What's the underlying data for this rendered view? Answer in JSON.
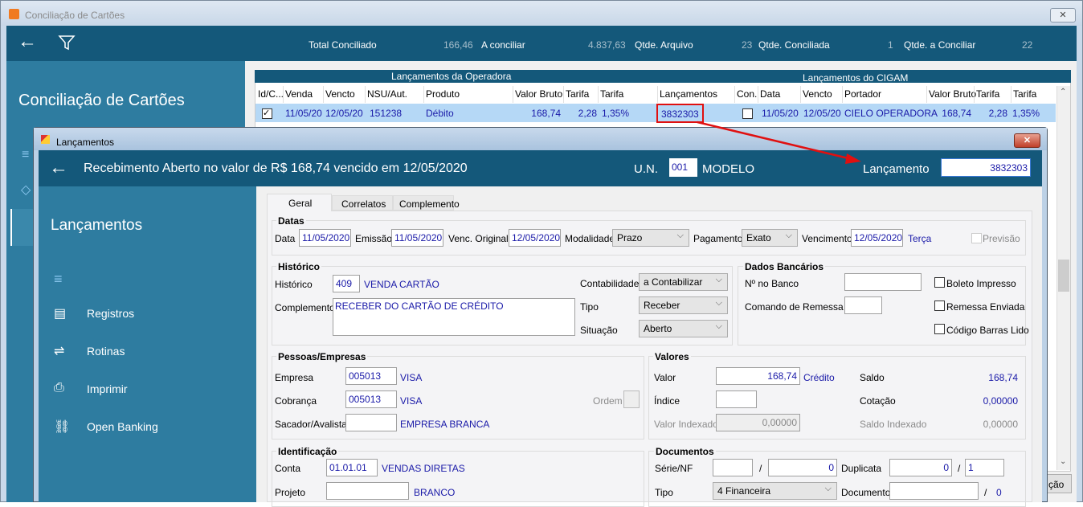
{
  "main_window": {
    "title": "Conciliação de Cartões",
    "close": "✕"
  },
  "summary": {
    "total_conciliado_label": "Total Conciliado",
    "total_conciliado": "166,46",
    "a_conciliar_label": "A conciliar",
    "a_conciliar": "4.837,63",
    "qtde_arquivo_label": "Qtde. Arquivo",
    "qtde_arquivo": "23",
    "qtde_conciliada_label": "Qtde. Conciliada",
    "qtde_conciliada": "1",
    "qtde_a_conciliar_label": "Qtde. a Conciliar",
    "qtde_a_conciliar": "22"
  },
  "sidebar": {
    "title": "Conciliação de Cartões"
  },
  "grid": {
    "operadora_title": "Lançamentos da Operadora",
    "cigam_title": "Lançamentos do CIGAM",
    "headers": [
      "Id/C...",
      "Venda",
      "Vencto",
      "NSU/Aut.",
      "Produto",
      "Valor Bruto",
      "Tarifa",
      "Tarifa",
      "Lançamentos",
      "Con.",
      "Data",
      "Vencto",
      "Portador",
      "Valor Bruto",
      "Tarifa",
      "Tarifa"
    ],
    "row": {
      "venda": "11/05/20",
      "vencto": "12/05/20",
      "nsu": "151238",
      "produto": "Débito",
      "valor_bruto": "168,74",
      "tarifa": "2,28",
      "tarifa_pct": "1,35%",
      "lancamento": "3832303",
      "data": "11/05/20",
      "vencto2": "12/05/20",
      "portador": "CIELO OPERADORA",
      "valor_bruto2": "168,74",
      "tarifa2": "2,28",
      "tarifa_pct2": "1,35%"
    }
  },
  "partial_button": "ção",
  "modal": {
    "title": "Lançamentos",
    "close": "✕",
    "header": "Recebimento Aberto no valor de R$ 168,74 vencido em 12/05/2020",
    "un_label": "U.N.",
    "un_value": "001",
    "un_name": "MODELO",
    "lancamento_label": "Lançamento",
    "lancamento_value": "3832303",
    "side_title": "Lançamentos",
    "menu": [
      "Registros",
      "Rotinas",
      "Imprimir",
      "Open Banking"
    ],
    "tabs": [
      "Geral",
      "Correlatos",
      "Complemento"
    ],
    "datas": {
      "legend": "Datas",
      "data_label": "Data",
      "data": "11/05/2020",
      "emissao_label": "Emissão",
      "emissao": "11/05/2020",
      "venc_orig_label": "Venc. Original",
      "venc_orig": "12/05/2020",
      "modalidade_label": "Modalidade",
      "modalidade": "Prazo",
      "pagamento_label": "Pagamento",
      "pagamento": "Exato",
      "vencimento_label": "Vencimento",
      "vencimento": "12/05/2020",
      "dia": "Terça",
      "previsao": "Previsão"
    },
    "historico": {
      "legend": "Histórico",
      "historico_label": "Histórico",
      "codigo": "409",
      "descricao": "VENDA CARTÃO",
      "complemento_label": "Complemento",
      "complemento": "RECEBER DO CARTÃO DE CRÉDITO",
      "contabilidade_label": "Contabilidade",
      "contabilidade": "a Contabilizar",
      "tipo_label": "Tipo",
      "tipo": "Receber",
      "situacao_label": "Situação",
      "situacao": "Aberto"
    },
    "bancarios": {
      "legend": "Dados Bancários",
      "no_banco": "Nº no Banco",
      "comando": "Comando de Remessa",
      "boleto": "Boleto Impresso",
      "remessa": "Remessa Enviada",
      "codigo_barras": "Código Barras Lido"
    },
    "pessoas": {
      "legend": "Pessoas/Empresas",
      "empresa_label": "Empresa",
      "empresa": "005013",
      "empresa_nome": "VISA",
      "cobranca_label": "Cobrança",
      "cobranca": "005013",
      "cobranca_nome": "VISA",
      "sacador_label": "Sacador/Avalista",
      "sacador_nome": "EMPRESA BRANCA",
      "ordem": "Ordem"
    },
    "valores": {
      "legend": "Valores",
      "valor_label": "Valor",
      "valor": "168,74",
      "credito": "Crédito",
      "saldo_label": "Saldo",
      "saldo": "168,74",
      "indice_label": "Índice",
      "cotacao_label": "Cotação",
      "cotacao": "0,00000",
      "valor_idx_label": "Valor Indexado",
      "valor_idx": "0,00000",
      "saldo_idx_label": "Saldo Indexado",
      "saldo_idx": "0,00000"
    },
    "identificacao": {
      "legend": "Identificação",
      "conta_label": "Conta",
      "conta": "01.01.01",
      "conta_nome": "VENDAS DIRETAS",
      "projeto_label": "Projeto",
      "projeto_nome": "BRANCO"
    },
    "documentos": {
      "legend": "Documentos",
      "serie_label": "Série/NF",
      "nf": "0",
      "slash": "/",
      "duplicata_label": "Duplicata",
      "duplicata": "0",
      "parcela": "1",
      "tipo_label": "Tipo",
      "tipo": "4 Financeira",
      "documento_label": "Documento",
      "doc_seq": "0"
    }
  },
  "colors": {
    "header": "#14587a",
    "sidebar": "#2e7ca0",
    "selected_row": "#b5d8f6",
    "highlight": "#e01010"
  }
}
